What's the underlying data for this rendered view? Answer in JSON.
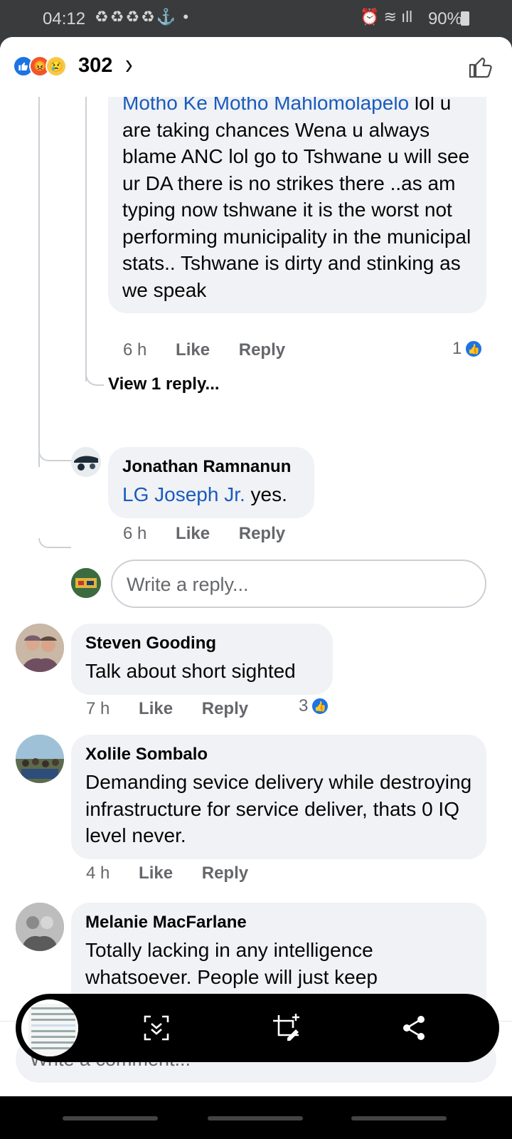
{
  "status_bar": {
    "time": "04:12",
    "notification_icons": "♻♻♻♻⚓ •",
    "battery": "90%"
  },
  "header": {
    "reaction_count": "302"
  },
  "comments": [
    {
      "mention": "Motho Ke Motho Mahlomolapelo",
      "text": " lol u are taking chances Wena u always blame ANC lol go to Tshwane u will see ur DA there is no strikes there ..as am typing now tshwane it is the worst not performing municipality in the municipal stats.. Tshwane is dirty and stinking as we speak",
      "time": "6 h",
      "like": "Like",
      "reply": "Reply",
      "likes": "1"
    },
    {
      "view_replies": "View 1 reply..."
    },
    {
      "name": "Jonathan Ramnanun",
      "mention": "LG Joseph Jr.",
      "text": " yes.",
      "time": "6 h",
      "like": "Like",
      "reply": "Reply"
    },
    {
      "reply_placeholder": "Write a reply..."
    },
    {
      "name": "Steven Gooding",
      "text": "Talk about short sighted",
      "time": "7 h",
      "like": "Like",
      "reply": "Reply",
      "likes": "3"
    },
    {
      "name": "Xolile Sombalo",
      "text": "Demanding sevice delivery while destroying  infrastructure for service deliver, thats  0 IQ level never.",
      "time": "4 h",
      "like": "Like",
      "reply": "Reply"
    },
    {
      "name": "Melanie MacFarlane",
      "text": "Totally lacking in any intelligence whatsoever. People will just keep destroying mindlessly without any"
    }
  ],
  "comment_bar": {
    "placeholder": "Write a comment..."
  },
  "colors": {
    "accent": "#1b74e4",
    "mention": "#1a5bbd",
    "bubble": "#f0f2f5"
  }
}
